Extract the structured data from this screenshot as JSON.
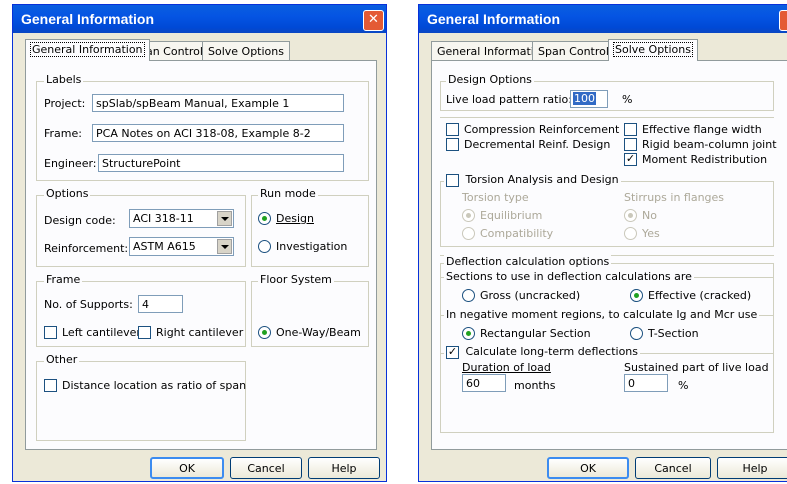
{
  "left_dialog": {
    "title": "General Information",
    "close": "✕",
    "tabs": [
      "General Information",
      "Span Control",
      "Solve Options"
    ],
    "labels_group": "Labels",
    "project_label": "Project:",
    "project_value": "spSlab/spBeam Manual, Example 1",
    "frame_label": "Frame:",
    "frame_value": "PCA Notes on ACI 318-08, Example 8-2",
    "engineer_label": "Engineer:",
    "engineer_value": "StructurePoint",
    "options_group": "Options",
    "design_code_label": "Design code:",
    "design_code_value": "ACI 318-11",
    "reinforcement_label": "Reinforcement:",
    "reinforcement_value": "ASTM A615",
    "run_mode_group": "Run mode",
    "run_mode_design": "Design",
    "run_mode_investigation": "Investigation",
    "frame_group": "Frame",
    "supports_label": "No. of Supports:",
    "supports_value": "4",
    "left_cantilever": "Left cantilever",
    "right_cantilever": "Right cantilever",
    "floor_group": "Floor System",
    "floor_one_way": "One-Way/Beam",
    "other_group": "Other",
    "distance_ratio": "Distance location as ratio of span",
    "ok": "OK",
    "cancel": "Cancel",
    "help": "Help"
  },
  "right_dialog": {
    "title": "General Information",
    "tabs": [
      "General Information",
      "Span Control",
      "Solve Options"
    ],
    "design_options_group": "Design Options",
    "live_load_label": "Live load pattern ratio:",
    "live_load_value": "100",
    "live_load_unit": "%",
    "compression_reinf": "Compression Reinforcement",
    "decremental_reinf": "Decremental Reinf. Design",
    "effective_flange": "Effective flange width",
    "rigid_joint": "Rigid beam-column joint",
    "moment_redistribution": "Moment Redistribution",
    "torsion_group": "Torsion Analysis and Design",
    "torsion_type": "Torsion type",
    "equilibrium": "Equilibrium",
    "compatibility": "Compatibility",
    "stirrups_flanges": "Stirrups in flanges",
    "no": "No",
    "yes": "Yes",
    "deflection_group": "Deflection calculation options",
    "sections_label": "Sections to use in deflection calculations are",
    "gross": "Gross (uncracked)",
    "effective": "Effective (cracked)",
    "neg_moment_label": "In negative moment regions, to calculate Ig and Mcr use",
    "rectangular": "Rectangular Section",
    "t_section": "T-Section",
    "long_term": "Calculate long-term deflections",
    "duration_label": "Duration of load",
    "duration_value": "60",
    "months": "months",
    "sustained_label": "Sustained part of live load",
    "sustained_value": "0",
    "sustained_unit": "%",
    "ok": "OK",
    "cancel": "Cancel",
    "help": "Help"
  }
}
